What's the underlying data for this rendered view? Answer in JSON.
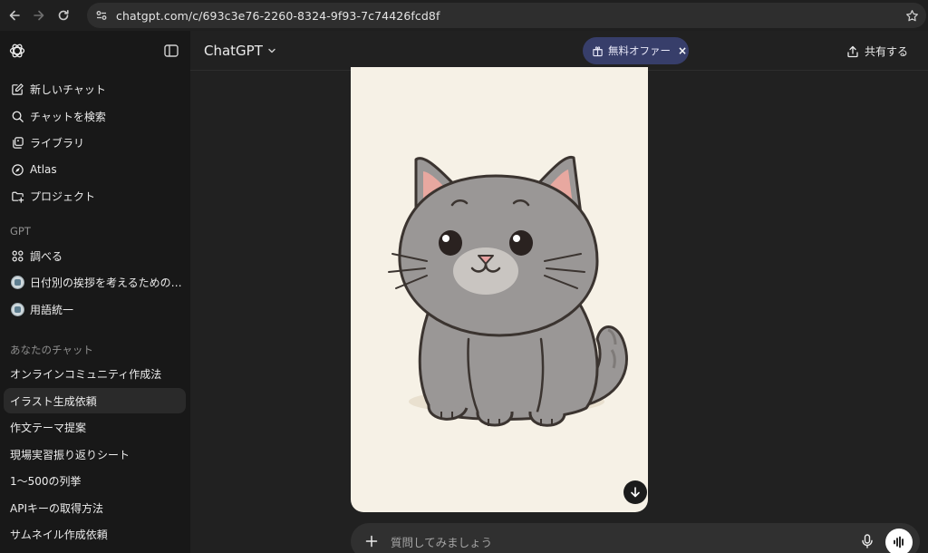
{
  "browser": {
    "url": "chatgpt.com/c/693c3e76-2260-8324-9f93-7c74426fcd8f"
  },
  "sidebar": {
    "nav": [
      {
        "label": "新しいチャット",
        "icon": "compose-icon"
      },
      {
        "label": "チャットを検索",
        "icon": "search-icon"
      },
      {
        "label": "ライブラリ",
        "icon": "library-icon"
      },
      {
        "label": "Atlas",
        "icon": "atlas-icon"
      },
      {
        "label": "プロジェクト",
        "icon": "folder-plus-icon"
      }
    ],
    "gpt_section": "GPT",
    "gpts": [
      {
        "label": "調べる",
        "icon": "explore-grid-icon"
      },
      {
        "label": "日付別の挨拶を考えるための…",
        "icon": "gpt-avatar-icon"
      },
      {
        "label": "用語統一",
        "icon": "gpt-avatar-icon"
      }
    ],
    "chats_section": "あなたのチャット",
    "chats": [
      {
        "label": "オンラインコミュニティ作成法",
        "active": false
      },
      {
        "label": "イラスト生成依頼",
        "active": true
      },
      {
        "label": "作文テーマ提案",
        "active": false
      },
      {
        "label": "現場実習振り返りシート",
        "active": false
      },
      {
        "label": "1〜500の列挙",
        "active": false
      },
      {
        "label": "APIキーの取得方法",
        "active": false
      },
      {
        "label": "サムネイル作成依頼",
        "active": false
      }
    ]
  },
  "header": {
    "model": "ChatGPT",
    "offer_label": "無料オファー",
    "offer_close": "×",
    "share_label": "共有する"
  },
  "composer": {
    "placeholder": "質問してみましょう"
  },
  "colors": {
    "sidebar_bg": "#181818",
    "main_bg": "#212121",
    "offer_bg": "#373e6a",
    "image_bg": "#f6f1e6"
  }
}
